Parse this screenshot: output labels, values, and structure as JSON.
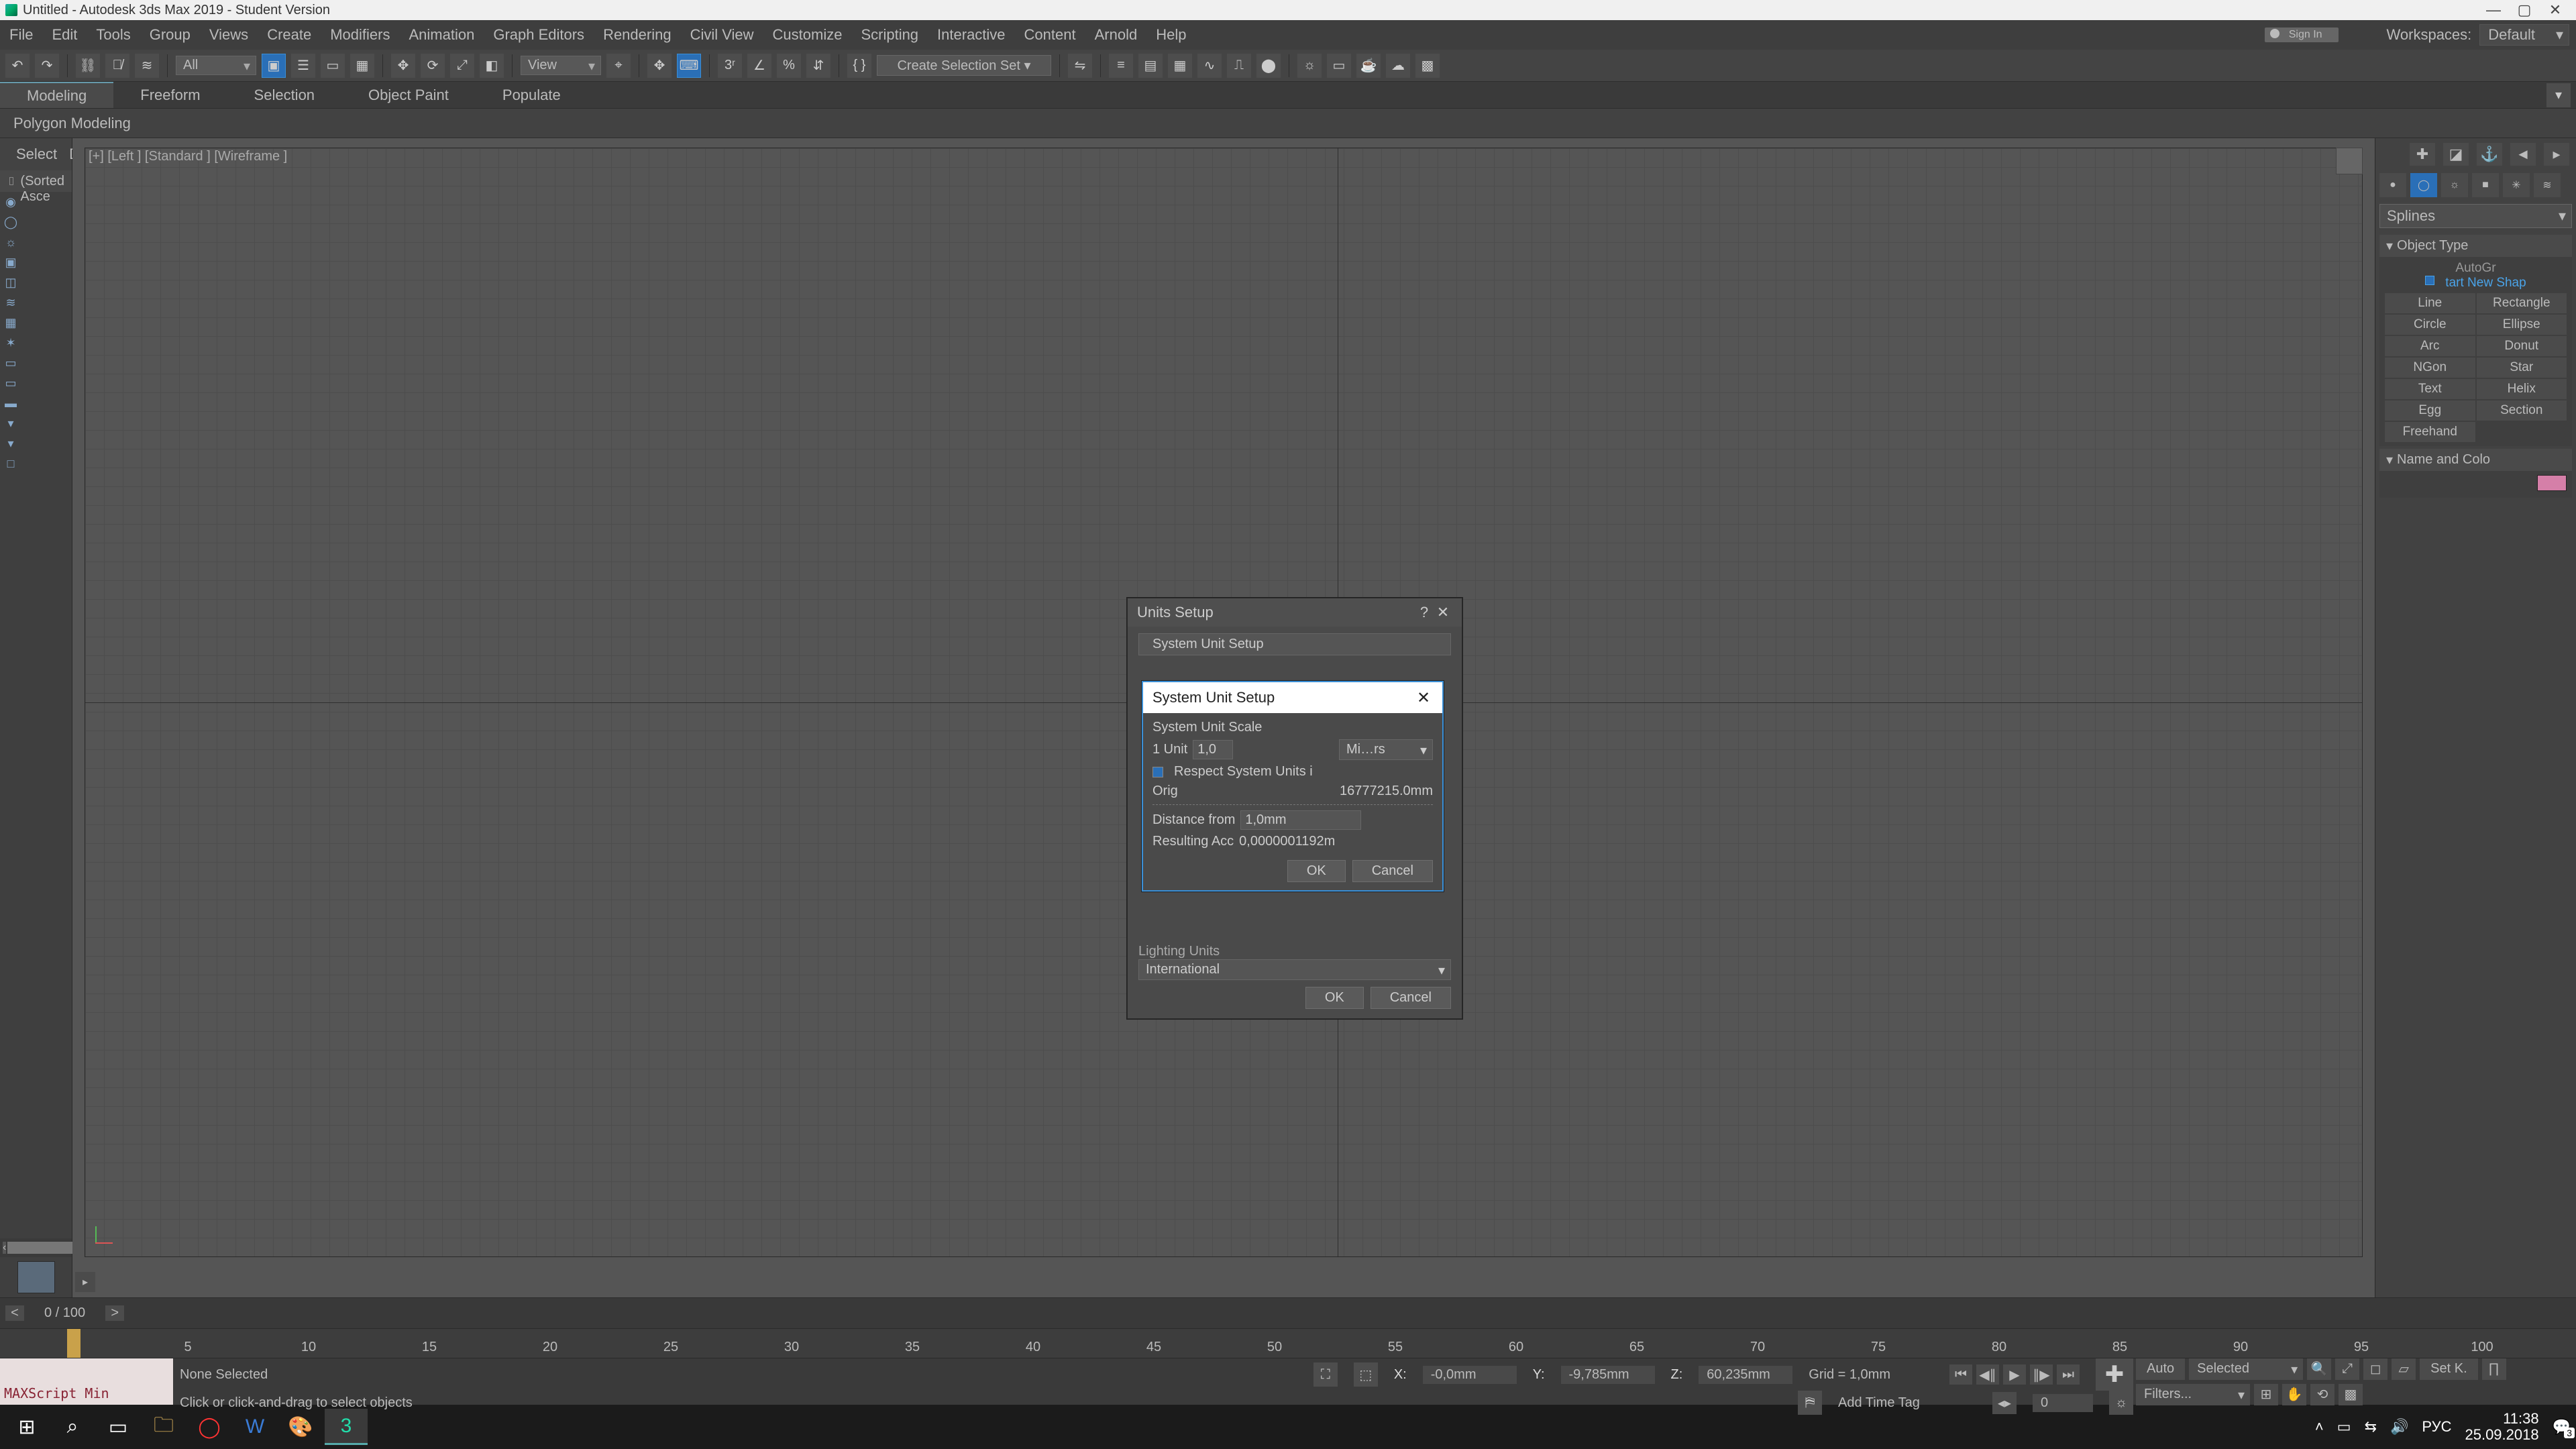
{
  "window": {
    "title": "Untitled - Autodesk 3ds Max 2019 - Student Version"
  },
  "menus": [
    "File",
    "Edit",
    "Tools",
    "Group",
    "Views",
    "Create",
    "Modifiers",
    "Animation",
    "Graph Editors",
    "Rendering",
    "Civil View",
    "Customize",
    "Scripting",
    "Interactive",
    "Content",
    "Arnold",
    "Help"
  ],
  "signin_label": "Sign In",
  "workspaces_label": "Workspaces:",
  "workspaces_value": "Default",
  "toolbar": {
    "filter_combo": "All",
    "view_combo": "View",
    "selection_set": "Create Selection Set  ▾"
  },
  "ribbon_tabs": [
    "Modeling",
    "Freeform",
    "Selection",
    "Object Paint",
    "Populate"
  ],
  "ribbon_sub": "Polygon Modeling",
  "scene_explorer": {
    "select": "Select",
    "display": "Display",
    "name_header": "Name (Sorted Asce"
  },
  "viewport_label": "[+] [Left ]  [Standard ]  [Wireframe ]",
  "command_panel": {
    "category": "Splines",
    "rollout1": "Object Type",
    "autogrid": "AutoGr",
    "start_shape": "tart New Shap",
    "buttons": [
      "Line",
      "Rectangle",
      "Circle",
      "Ellipse",
      "Arc",
      "Donut",
      "NGon",
      "Star",
      "Text",
      "Helix",
      "Egg",
      "Section",
      "Freehand",
      ""
    ],
    "rollout2": "Name and Colo"
  },
  "time": {
    "frame_label": "0 / 100",
    "ticks": [
      "5",
      "10",
      "15",
      "20",
      "25",
      "30",
      "35",
      "40",
      "45",
      "50",
      "55",
      "60",
      "65",
      "70",
      "75",
      "80",
      "85",
      "90",
      "95",
      "100"
    ]
  },
  "status": {
    "maxscript": "MAXScript Min",
    "none_selected": "None Selected",
    "hint": "Click or click-and-drag to select objects",
    "x_label": "X:",
    "x_val": "-0,0mm",
    "y_label": "Y:",
    "y_val": "-9,785mm",
    "z_label": "Z:",
    "z_val": "60,235mm",
    "grid": "Grid = 1,0mm",
    "add_time_tag": "Add Time Tag",
    "spinner": "0",
    "auto": "Auto",
    "setk": "Set K.",
    "selected": "Selected",
    "filters": "Filters..."
  },
  "units_dialog": {
    "title": "Units Setup",
    "system_btn": "System Unit Setup",
    "lighting_units": "Lighting Units",
    "lighting_value": "International",
    "ok": "OK",
    "cancel": "Cancel"
  },
  "sysunit_dialog": {
    "title": "System Unit Setup",
    "scale_label": "System Unit Scale",
    "one_unit": "1 Unit",
    "one_unit_val": "1,0",
    "unit_combo": "Mi…rs",
    "respect": "Respect System Units i",
    "origin_label": "Orig",
    "origin_val": "16777215.0mm",
    "distance_label": "Distance from",
    "distance_val": "1,0mm",
    "accuracy_label": "Resulting Acc",
    "accuracy_val": "0,0000001192m",
    "ok": "OK",
    "cancel": "Cancel"
  },
  "taskbar": {
    "lang": "РУС",
    "time": "11:38",
    "date": "25.09.2018",
    "notif_count": "3"
  }
}
